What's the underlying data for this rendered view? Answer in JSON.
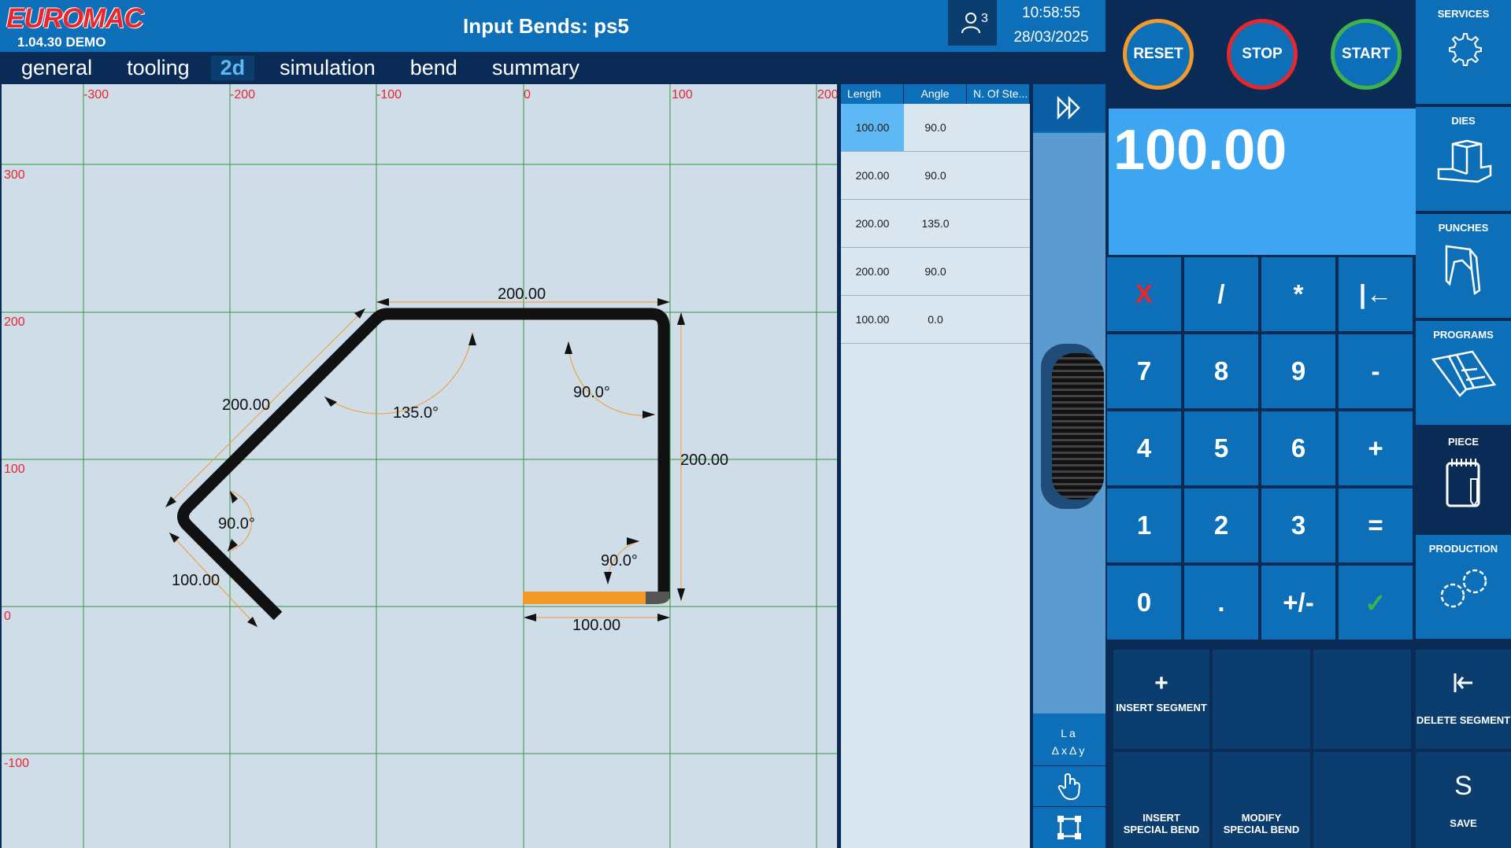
{
  "header": {
    "logo": "EUROMAC",
    "version": "1.04.30 DEMO",
    "title": "Input Bends: ps5",
    "user_count": "3",
    "time": "10:58:55",
    "date": "28/03/2025"
  },
  "tabs": [
    "general",
    "tooling",
    "2d",
    "simulation",
    "bend",
    "summary"
  ],
  "active_tab": "2d",
  "drawing": {
    "x_ticks": [
      "-300",
      "-200",
      "-100",
      "0",
      "100",
      "200"
    ],
    "y_ticks": [
      "300",
      "200",
      "100",
      "0",
      "-100"
    ],
    "dims": {
      "top_length": "200.00",
      "left_diag_length": "200.00",
      "right_vertical_length": "200.00",
      "bottom_length": "100.00",
      "left_short_length": "100.00",
      "angle_135": "135.0°",
      "angle_top_right": "90.0°",
      "angle_left": "90.0°",
      "angle_bottom_right": "90.0°"
    }
  },
  "table": {
    "headers": [
      "Length",
      "Angle",
      "N. Of Ste..."
    ],
    "rows": [
      {
        "length": "100.00",
        "angle": "90.0"
      },
      {
        "length": "200.00",
        "angle": "90.0"
      },
      {
        "length": "200.00",
        "angle": "135.0"
      },
      {
        "length": "200.00",
        "angle": "90.0"
      },
      {
        "length": "100.00",
        "angle": "0.0"
      }
    ]
  },
  "strip": {
    "la_line1": "La",
    "la_line2": "ΔxΔy"
  },
  "controls": {
    "reset": "RESET",
    "stop": "STOP",
    "start": "START",
    "display_value": "100.00"
  },
  "keypad": {
    "row1": [
      "X",
      "/",
      "*",
      "|←"
    ],
    "row2": [
      "7",
      "8",
      "9",
      "-"
    ],
    "row3": [
      "4",
      "5",
      "6",
      "+"
    ],
    "row4": [
      "1",
      "2",
      "3",
      "="
    ],
    "row5": [
      "0",
      ".",
      "+/-",
      "✓"
    ]
  },
  "segments": {
    "insert_segment": "INSERT SEGMENT",
    "delete_segment": "DELETE SEGMENT",
    "insert_special_1": "INSERT",
    "insert_special_2": "SPECIAL BEND",
    "modify_special_1": "MODIFY",
    "modify_special_2": "SPECIAL BEND",
    "save": "SAVE",
    "save_icon": "S"
  },
  "nav": {
    "services": "SERVICES",
    "dies": "DIES",
    "punches": "PUNCHES",
    "programs": "PROGRAMS",
    "piece": "PIECE",
    "production": "PRODUCTION"
  },
  "colors": {
    "brand_blue": "#0d6fb7",
    "dark_navy": "#0a2b55",
    "display_blue": "#3ea6f0",
    "reset_ring": "#f39a2b",
    "stop_ring": "#e8262c",
    "start_ring": "#3fb24a",
    "dimension_orange": "#f39a2b"
  }
}
